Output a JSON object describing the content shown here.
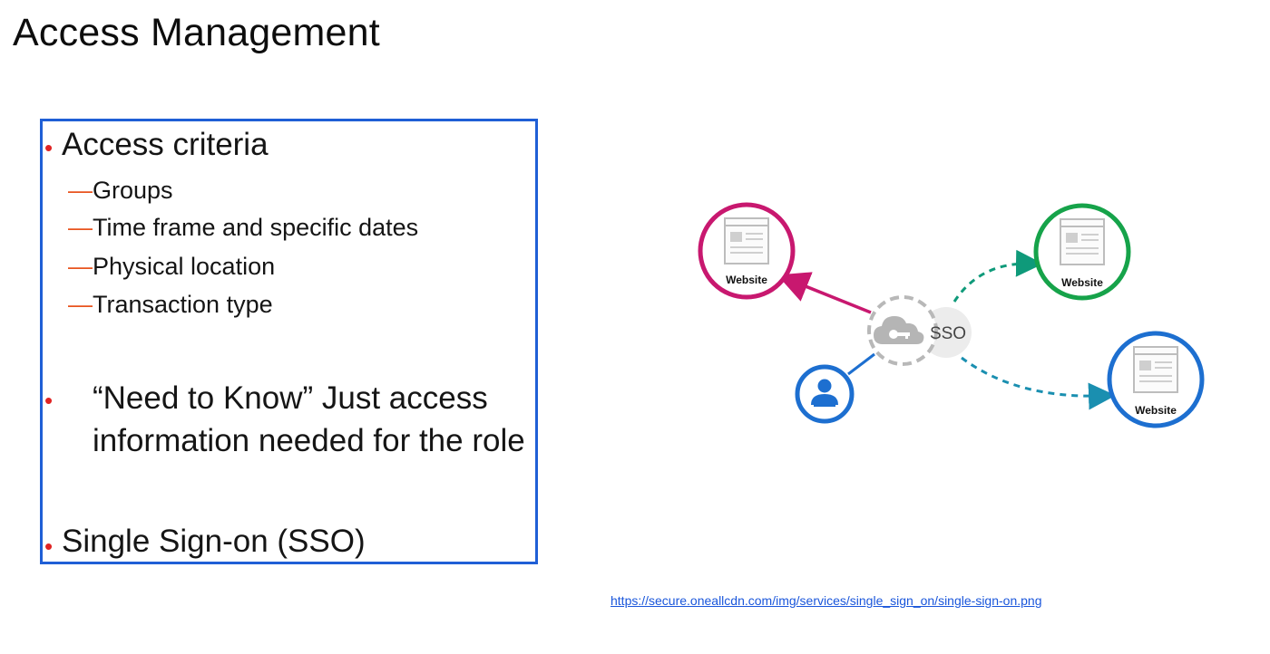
{
  "slide": {
    "title": "Access Management"
  },
  "content": {
    "access_criteria": {
      "label": "Access criteria",
      "sub_items": [
        "Groups",
        "Time frame and specific dates",
        "Physical location",
        "Transaction type"
      ]
    },
    "need_to_know": "“Need to Know”  Just access information needed for the role",
    "sso": "Single Sign-on (SSO)"
  },
  "diagram": {
    "hub_label": "SSO",
    "sites": [
      {
        "label": "Website",
        "color": "#c8186f"
      },
      {
        "label": "Website",
        "color": "#16a34a"
      },
      {
        "label": "Website",
        "color": "#1d6fd0"
      }
    ],
    "user_color": "#1d6fd0",
    "arrow_colors": [
      "#c8186f",
      "#0f9a7a",
      "#1a8fb0"
    ]
  },
  "source_link": "https://secure.oneallcdn.com/img/services/single_sign_on/single-sign-on.png"
}
